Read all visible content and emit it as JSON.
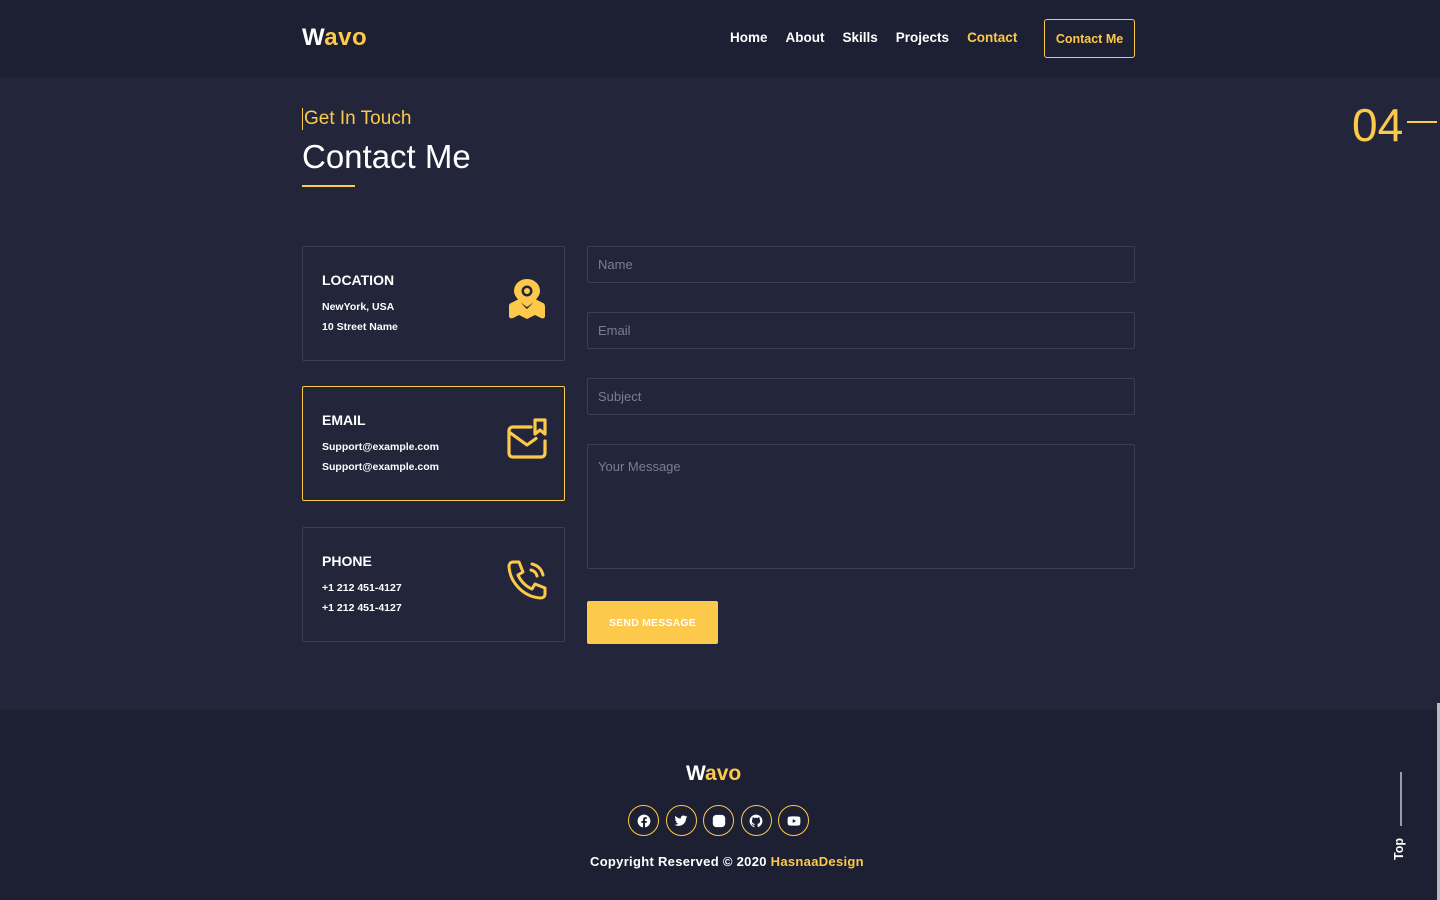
{
  "header": {
    "logo_first": "W",
    "logo_rest": "avo",
    "nav": [
      "Home",
      "About",
      "Skills",
      "Projects",
      "Contact"
    ],
    "active_nav": "Contact",
    "cta": "Contact Me"
  },
  "section": {
    "index": "04",
    "eyebrow": "Get In Touch",
    "title": "Contact Me"
  },
  "cards": [
    {
      "label": "LOCATION",
      "line1": "NewYork, USA",
      "line2": "10 Street Name",
      "icon": "map-pin-icon"
    },
    {
      "label": "EMAIL",
      "line1": "Support@example.com",
      "line2": "Support@example.com",
      "icon": "mail-icon"
    },
    {
      "label": "PHONE",
      "line1": "+1 212 451-4127",
      "line2": "+1 212 451-4127",
      "icon": "phone-icon"
    }
  ],
  "form": {
    "name_placeholder": "Name",
    "email_placeholder": "Email",
    "subject_placeholder": "Subject",
    "message_placeholder": "Your Message",
    "submit": "SEND MESSAGE"
  },
  "footer": {
    "logo_first": "W",
    "logo_rest": "avo",
    "socials": [
      "facebook-icon",
      "twitter-icon",
      "instagram-icon",
      "github-icon",
      "youtube-icon"
    ],
    "copyright_prefix": "Copyright Reserved © 2020 ",
    "copyright_brand": "HasnaaDesign"
  },
  "top_button": "Top",
  "colors": {
    "accent": "#fdc94a",
    "background": "#23263a",
    "header": "#1d2032"
  }
}
